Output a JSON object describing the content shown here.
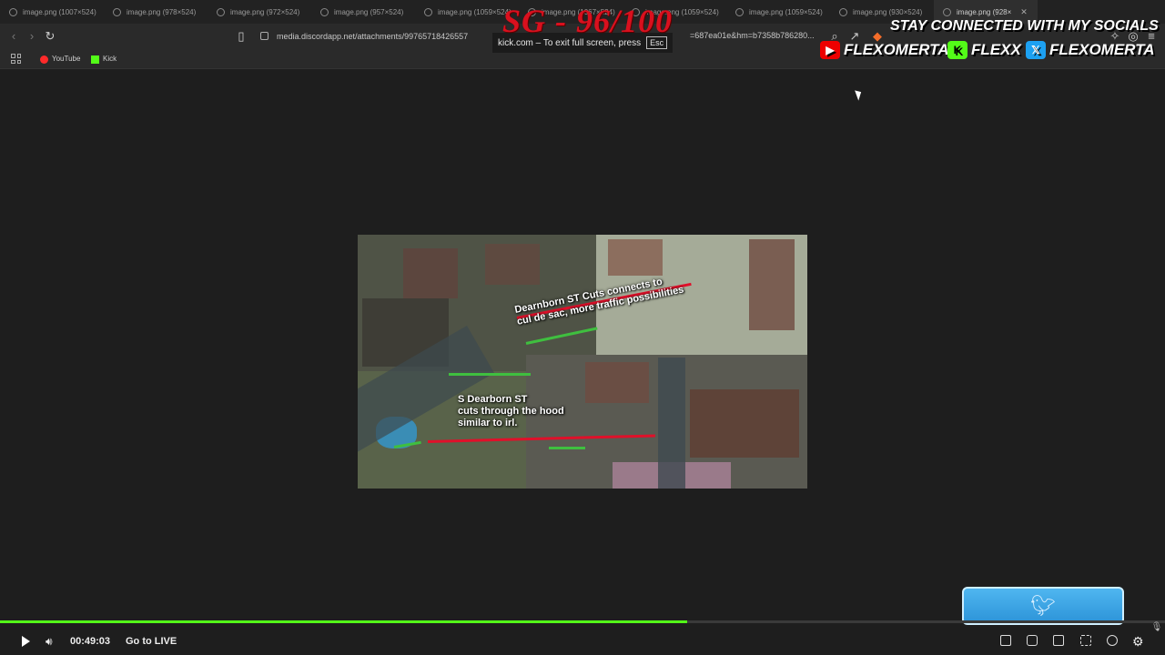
{
  "tabs": [
    {
      "title": "image.png (1007×524)",
      "active": false
    },
    {
      "title": "image.png (978×524)",
      "active": false
    },
    {
      "title": "image.png (972×524)",
      "active": false
    },
    {
      "title": "image.png (957×524)",
      "active": false
    },
    {
      "title": "image.png (1059×524)",
      "active": false
    },
    {
      "title": "image.png (1067×524)",
      "active": false
    },
    {
      "title": "image.png (1059×524)",
      "active": false
    },
    {
      "title": "image.png (1059×524)",
      "active": false
    },
    {
      "title": "image.png (930×524)",
      "active": false
    },
    {
      "title": "image.png (928×",
      "active": true
    }
  ],
  "address": {
    "url": "media.discordapp.net/attachments/99765718426557",
    "url_tail": "=687ea01e&hm=b7358b786280..."
  },
  "bookmarks": [
    {
      "label": "YouTube",
      "icon": "youtube-icon"
    },
    {
      "label": "Kick",
      "icon": "kick-icon"
    }
  ],
  "toast": {
    "text": "kick.com – To exit full screen, press",
    "key": "Esc"
  },
  "overlay": {
    "score": "SG - 96/100",
    "social_heading": "STAY CONNECTED WITH MY SOCIALS",
    "socials": [
      {
        "platform": "youtube",
        "handle": "FLEXOMERTA"
      },
      {
        "platform": "kick",
        "handle": "FLEXX"
      },
      {
        "platform": "twitter",
        "handle": "FLEXOMERTA"
      }
    ]
  },
  "image": {
    "label_top_line1": "Dearnborn ST Cuts connects to",
    "label_top_line2": "cul de sac, more traffic possibilities",
    "label_bottom_line1": "S Dearborn ST",
    "label_bottom_line2": "cuts through the hood",
    "label_bottom_line3": "similar to irl."
  },
  "player": {
    "time": "00:49:03",
    "live_label": "Go to LIVE",
    "progress": 0.59
  },
  "colors": {
    "kick_green": "#53fc18",
    "score_red": "#d9101e",
    "twitter_blue": "#1da1f2"
  }
}
